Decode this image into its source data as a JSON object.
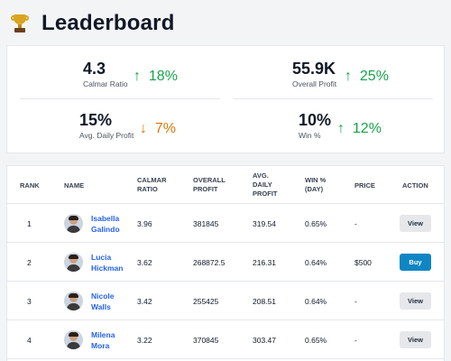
{
  "header": {
    "title": "Leaderboard",
    "icon": "trophy-icon"
  },
  "stats": [
    {
      "value": "4.3",
      "label": "Calmar Ratio",
      "change": "18%",
      "direction": "up"
    },
    {
      "value": "55.9K",
      "label": "Overall Profit",
      "change": "25%",
      "direction": "up"
    },
    {
      "value": "15%",
      "label": "Avg. Daily Profit",
      "change": "7%",
      "direction": "down"
    },
    {
      "value": "10%",
      "label": "Win %",
      "change": "12%",
      "direction": "up"
    }
  ],
  "table": {
    "headers": {
      "rank": "RANK",
      "name": "NAME",
      "calmar_1": "CALMAR",
      "calmar_2": "RATIO",
      "profit_1": "OVERALL",
      "profit_2": "PROFIT",
      "avg_1": "AVG.",
      "avg_2": "DAILY",
      "avg_3": "PROFIT",
      "win_1": "WIN %",
      "win_2": "(DAY)",
      "price": "PRICE",
      "action": "ACTION"
    },
    "rows": [
      {
        "rank": "1",
        "first": "Isabella",
        "last": "Galindo",
        "calmar": "3.96",
        "profit": "381845",
        "avg": "319.54",
        "win": "0.65%",
        "price": "-",
        "action": "View"
      },
      {
        "rank": "2",
        "first": "Lucia",
        "last": "Hickman",
        "calmar": "3.62",
        "profit": "268872.5",
        "avg": "216.31",
        "win": "0.64%",
        "price": "$500",
        "action": "Buy"
      },
      {
        "rank": "3",
        "first": "Nicole",
        "last": "Walls",
        "calmar": "3.42",
        "profit": "255425",
        "avg": "208.51",
        "win": "0.64%",
        "price": "-",
        "action": "View"
      },
      {
        "rank": "4",
        "first": "Milena",
        "last": "Mora",
        "calmar": "3.22",
        "profit": "370845",
        "avg": "303.47",
        "win": "0.65%",
        "price": "-",
        "action": "View"
      }
    ]
  },
  "colors": {
    "accent": "#2563eb",
    "up": "#16a34a",
    "down": "#d97706",
    "buy": "#0f86c4"
  }
}
